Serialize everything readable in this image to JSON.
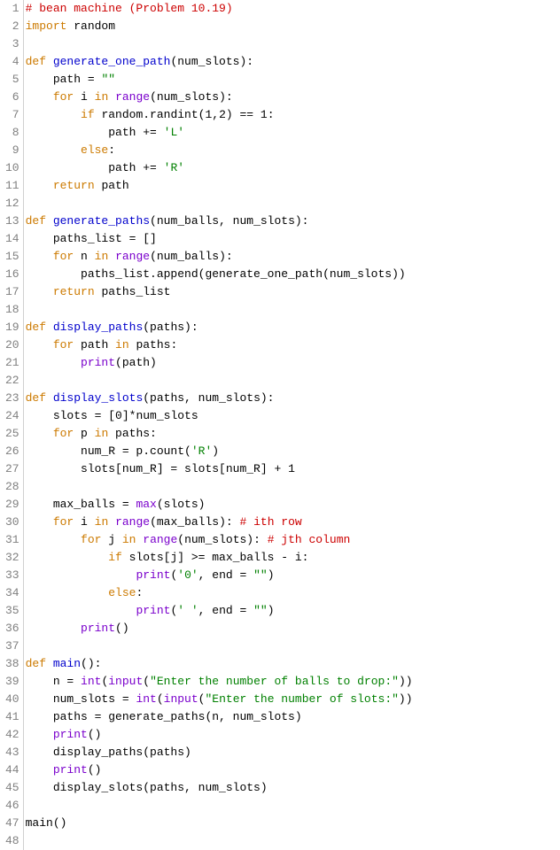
{
  "lines": [
    {
      "n": 1,
      "tokens": [
        [
          "c-comment",
          "# bean machine (Problem 10.19)"
        ]
      ]
    },
    {
      "n": 2,
      "tokens": [
        [
          "c-keyword",
          "import"
        ],
        [
          "c-text",
          " random"
        ]
      ]
    },
    {
      "n": 3,
      "tokens": []
    },
    {
      "n": 4,
      "tokens": [
        [
          "c-keyword",
          "def"
        ],
        [
          "c-text",
          " "
        ],
        [
          "c-def",
          "generate_one_path"
        ],
        [
          "c-text",
          "(num_slots):"
        ]
      ]
    },
    {
      "n": 5,
      "tokens": [
        [
          "c-text",
          "    path = "
        ],
        [
          "c-string",
          "\"\""
        ]
      ]
    },
    {
      "n": 6,
      "tokens": [
        [
          "c-text",
          "    "
        ],
        [
          "c-keyword",
          "for"
        ],
        [
          "c-text",
          " i "
        ],
        [
          "c-keyword",
          "in"
        ],
        [
          "c-text",
          " "
        ],
        [
          "c-builtin",
          "range"
        ],
        [
          "c-text",
          "(num_slots):"
        ]
      ]
    },
    {
      "n": 7,
      "tokens": [
        [
          "c-text",
          "        "
        ],
        [
          "c-keyword",
          "if"
        ],
        [
          "c-text",
          " random.randint("
        ],
        [
          "c-number",
          "1"
        ],
        [
          "c-text",
          ","
        ],
        [
          "c-number",
          "2"
        ],
        [
          "c-text",
          ") == "
        ],
        [
          "c-number",
          "1"
        ],
        [
          "c-text",
          ":"
        ]
      ]
    },
    {
      "n": 8,
      "tokens": [
        [
          "c-text",
          "            path += "
        ],
        [
          "c-string",
          "'L'"
        ]
      ]
    },
    {
      "n": 9,
      "tokens": [
        [
          "c-text",
          "        "
        ],
        [
          "c-keyword",
          "else"
        ],
        [
          "c-text",
          ":"
        ]
      ]
    },
    {
      "n": 10,
      "tokens": [
        [
          "c-text",
          "            path += "
        ],
        [
          "c-string",
          "'R'"
        ]
      ]
    },
    {
      "n": 11,
      "tokens": [
        [
          "c-text",
          "    "
        ],
        [
          "c-keyword",
          "return"
        ],
        [
          "c-text",
          " path"
        ]
      ]
    },
    {
      "n": 12,
      "tokens": []
    },
    {
      "n": 13,
      "tokens": [
        [
          "c-keyword",
          "def"
        ],
        [
          "c-text",
          " "
        ],
        [
          "c-def",
          "generate_paths"
        ],
        [
          "c-text",
          "(num_balls, num_slots):"
        ]
      ]
    },
    {
      "n": 14,
      "tokens": [
        [
          "c-text",
          "    paths_list = []"
        ]
      ]
    },
    {
      "n": 15,
      "tokens": [
        [
          "c-text",
          "    "
        ],
        [
          "c-keyword",
          "for"
        ],
        [
          "c-text",
          " n "
        ],
        [
          "c-keyword",
          "in"
        ],
        [
          "c-text",
          " "
        ],
        [
          "c-builtin",
          "range"
        ],
        [
          "c-text",
          "(num_balls):"
        ]
      ]
    },
    {
      "n": 16,
      "tokens": [
        [
          "c-text",
          "        paths_list.append(generate_one_path(num_slots))"
        ]
      ]
    },
    {
      "n": 17,
      "tokens": [
        [
          "c-text",
          "    "
        ],
        [
          "c-keyword",
          "return"
        ],
        [
          "c-text",
          " paths_list"
        ]
      ]
    },
    {
      "n": 18,
      "tokens": []
    },
    {
      "n": 19,
      "tokens": [
        [
          "c-keyword",
          "def"
        ],
        [
          "c-text",
          " "
        ],
        [
          "c-def",
          "display_paths"
        ],
        [
          "c-text",
          "(paths):"
        ]
      ]
    },
    {
      "n": 20,
      "tokens": [
        [
          "c-text",
          "    "
        ],
        [
          "c-keyword",
          "for"
        ],
        [
          "c-text",
          " path "
        ],
        [
          "c-keyword",
          "in"
        ],
        [
          "c-text",
          " paths:"
        ]
      ]
    },
    {
      "n": 21,
      "tokens": [
        [
          "c-text",
          "        "
        ],
        [
          "c-builtin",
          "print"
        ],
        [
          "c-text",
          "(path)"
        ]
      ]
    },
    {
      "n": 22,
      "tokens": []
    },
    {
      "n": 23,
      "tokens": [
        [
          "c-keyword",
          "def"
        ],
        [
          "c-text",
          " "
        ],
        [
          "c-def",
          "display_slots"
        ],
        [
          "c-text",
          "(paths, num_slots):"
        ]
      ]
    },
    {
      "n": 24,
      "tokens": [
        [
          "c-text",
          "    slots = ["
        ],
        [
          "c-number",
          "0"
        ],
        [
          "c-text",
          "]*num_slots"
        ]
      ]
    },
    {
      "n": 25,
      "tokens": [
        [
          "c-text",
          "    "
        ],
        [
          "c-keyword",
          "for"
        ],
        [
          "c-text",
          " p "
        ],
        [
          "c-keyword",
          "in"
        ],
        [
          "c-text",
          " paths:"
        ]
      ]
    },
    {
      "n": 26,
      "tokens": [
        [
          "c-text",
          "        num_R = p.count("
        ],
        [
          "c-string",
          "'R'"
        ],
        [
          "c-text",
          ")"
        ]
      ]
    },
    {
      "n": 27,
      "tokens": [
        [
          "c-text",
          "        slots[num_R] = slots[num_R] + "
        ],
        [
          "c-number",
          "1"
        ]
      ]
    },
    {
      "n": 28,
      "tokens": []
    },
    {
      "n": 29,
      "tokens": [
        [
          "c-text",
          "    max_balls = "
        ],
        [
          "c-builtin",
          "max"
        ],
        [
          "c-text",
          "(slots)"
        ]
      ]
    },
    {
      "n": 30,
      "tokens": [
        [
          "c-text",
          "    "
        ],
        [
          "c-keyword",
          "for"
        ],
        [
          "c-text",
          " i "
        ],
        [
          "c-keyword",
          "in"
        ],
        [
          "c-text",
          " "
        ],
        [
          "c-builtin",
          "range"
        ],
        [
          "c-text",
          "(max_balls): "
        ],
        [
          "c-comment",
          "# ith row"
        ]
      ]
    },
    {
      "n": 31,
      "tokens": [
        [
          "c-text",
          "        "
        ],
        [
          "c-keyword",
          "for"
        ],
        [
          "c-text",
          " j "
        ],
        [
          "c-keyword",
          "in"
        ],
        [
          "c-text",
          " "
        ],
        [
          "c-builtin",
          "range"
        ],
        [
          "c-text",
          "(num_slots): "
        ],
        [
          "c-comment",
          "# jth column"
        ]
      ]
    },
    {
      "n": 32,
      "tokens": [
        [
          "c-text",
          "            "
        ],
        [
          "c-keyword",
          "if"
        ],
        [
          "c-text",
          " slots[j] >= max_balls - i:"
        ]
      ]
    },
    {
      "n": 33,
      "tokens": [
        [
          "c-text",
          "                "
        ],
        [
          "c-builtin",
          "print"
        ],
        [
          "c-text",
          "("
        ],
        [
          "c-string",
          "'0'"
        ],
        [
          "c-text",
          ", end = "
        ],
        [
          "c-string",
          "\"\""
        ],
        [
          "c-text",
          ")"
        ]
      ]
    },
    {
      "n": 34,
      "tokens": [
        [
          "c-text",
          "            "
        ],
        [
          "c-keyword",
          "else"
        ],
        [
          "c-text",
          ":"
        ]
      ]
    },
    {
      "n": 35,
      "tokens": [
        [
          "c-text",
          "                "
        ],
        [
          "c-builtin",
          "print"
        ],
        [
          "c-text",
          "("
        ],
        [
          "c-string",
          "' '"
        ],
        [
          "c-text",
          ", end = "
        ],
        [
          "c-string",
          "\"\""
        ],
        [
          "c-text",
          ")"
        ]
      ]
    },
    {
      "n": 36,
      "tokens": [
        [
          "c-text",
          "        "
        ],
        [
          "c-builtin",
          "print"
        ],
        [
          "c-text",
          "()"
        ]
      ]
    },
    {
      "n": 37,
      "tokens": []
    },
    {
      "n": 38,
      "tokens": [
        [
          "c-keyword",
          "def"
        ],
        [
          "c-text",
          " "
        ],
        [
          "c-def",
          "main"
        ],
        [
          "c-text",
          "():"
        ]
      ]
    },
    {
      "n": 39,
      "tokens": [
        [
          "c-text",
          "    n = "
        ],
        [
          "c-builtin",
          "int"
        ],
        [
          "c-text",
          "("
        ],
        [
          "c-builtin",
          "input"
        ],
        [
          "c-text",
          "("
        ],
        [
          "c-string",
          "\"Enter the number of balls to drop:\""
        ],
        [
          "c-text",
          "))"
        ]
      ]
    },
    {
      "n": 40,
      "tokens": [
        [
          "c-text",
          "    num_slots = "
        ],
        [
          "c-builtin",
          "int"
        ],
        [
          "c-text",
          "("
        ],
        [
          "c-builtin",
          "input"
        ],
        [
          "c-text",
          "("
        ],
        [
          "c-string",
          "\"Enter the number of slots:\""
        ],
        [
          "c-text",
          "))"
        ]
      ]
    },
    {
      "n": 41,
      "tokens": [
        [
          "c-text",
          "    paths = generate_paths(n, num_slots)"
        ]
      ]
    },
    {
      "n": 42,
      "tokens": [
        [
          "c-text",
          "    "
        ],
        [
          "c-builtin",
          "print"
        ],
        [
          "c-text",
          "()"
        ]
      ]
    },
    {
      "n": 43,
      "tokens": [
        [
          "c-text",
          "    display_paths(paths)"
        ]
      ]
    },
    {
      "n": 44,
      "tokens": [
        [
          "c-text",
          "    "
        ],
        [
          "c-builtin",
          "print"
        ],
        [
          "c-text",
          "()"
        ]
      ]
    },
    {
      "n": 45,
      "tokens": [
        [
          "c-text",
          "    display_slots(paths, num_slots)"
        ]
      ]
    },
    {
      "n": 46,
      "tokens": []
    },
    {
      "n": 47,
      "tokens": [
        [
          "c-text",
          "main()"
        ]
      ]
    },
    {
      "n": 48,
      "tokens": []
    }
  ]
}
